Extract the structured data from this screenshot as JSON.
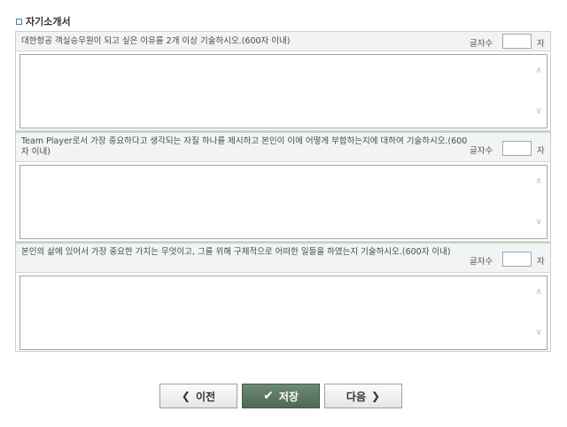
{
  "section": {
    "title": "자기소개서",
    "bullet_icon": "square-bullet-icon"
  },
  "questions": [
    {
      "text": "대한항공 객실승무원이 되고 싶은 이유를 2개 이상 기술하시오.(600자 이내)",
      "count_label": "글자수",
      "count_value": "",
      "count_unit": "자",
      "answer": ""
    },
    {
      "text": "Team Player로서 가장 중요하다고 생각되는 자질 하나를 제시하고 본인이 이에 어떻게 부합하는지에 대하여 기술하시오.(600자 이내)",
      "count_label": "글자수",
      "count_value": "",
      "count_unit": "자",
      "answer": ""
    },
    {
      "text": "본인의 삶에 있어서 가장 중요한 가치는 무엇이고, 그를 위해 구체적으로 어떠한 일들을 하였는지 기술하시오.(600자 이내)",
      "count_label": "글자수",
      "count_value": "",
      "count_unit": "자",
      "answer": ""
    }
  ],
  "buttons": {
    "prev_label": "이전",
    "prev_icon": "chevron-left-icon",
    "save_label": "저장",
    "save_icon": "check-icon",
    "next_label": "다음",
    "next_icon": "chevron-right-icon"
  },
  "colors": {
    "accent_bullet": "#3d7fb2",
    "save_button": "#5a7561",
    "question_bg": "#f1f4f2"
  }
}
